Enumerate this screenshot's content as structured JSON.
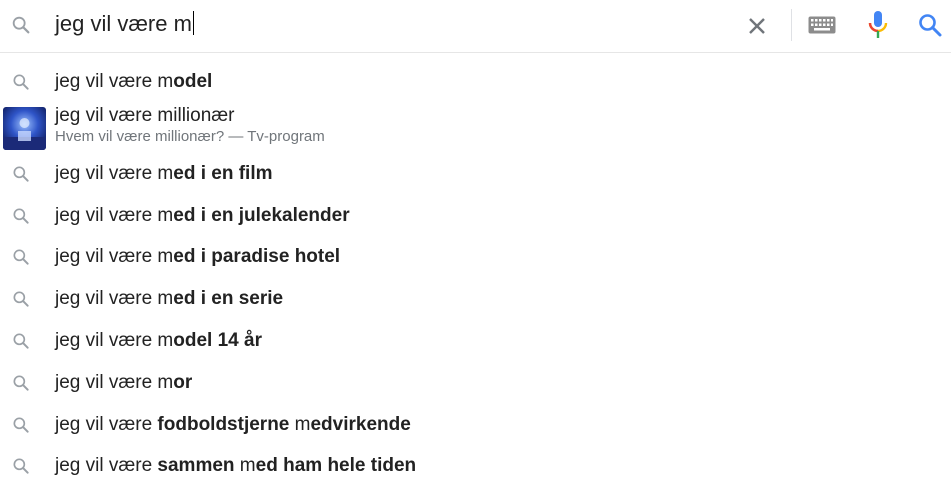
{
  "search": {
    "query": "jeg vil være m"
  },
  "icons": {
    "search": "search-icon",
    "clear": "close-icon",
    "keyboard": "keyboard-icon",
    "mic": "microphone-icon"
  },
  "colors": {
    "search_blue": "#4285f4",
    "mic_red": "#ea4335",
    "mic_yellow": "#fbbc05",
    "mic_green": "#34a853"
  },
  "suggestions": [
    {
      "prefix": "jeg vil være m",
      "bold": "odel",
      "suffix": ""
    },
    {
      "rich": true,
      "title": "jeg vil være millionær",
      "subtitle": "Hvem vil være millionær? — Tv-program"
    },
    {
      "prefix": "jeg vil være m",
      "bold": "ed i en film",
      "suffix": ""
    },
    {
      "prefix": "jeg vil være m",
      "bold": "ed i en julekalender",
      "suffix": ""
    },
    {
      "prefix": "jeg vil være m",
      "bold": "ed i paradise hotel",
      "suffix": ""
    },
    {
      "prefix": "jeg vil være m",
      "bold": "ed i en serie",
      "suffix": ""
    },
    {
      "prefix": "jeg vil være m",
      "bold": "odel 14 år",
      "suffix": ""
    },
    {
      "prefix": "jeg vil være m",
      "bold": "or",
      "suffix": ""
    },
    {
      "prefix": "jeg vil være ",
      "bold": "fodboldstjerne",
      "mid": " m",
      "bold2": "edvirkende"
    },
    {
      "prefix": "jeg vil være ",
      "bold": "sammen",
      "mid": " m",
      "bold2": "ed ham hele tiden"
    }
  ]
}
